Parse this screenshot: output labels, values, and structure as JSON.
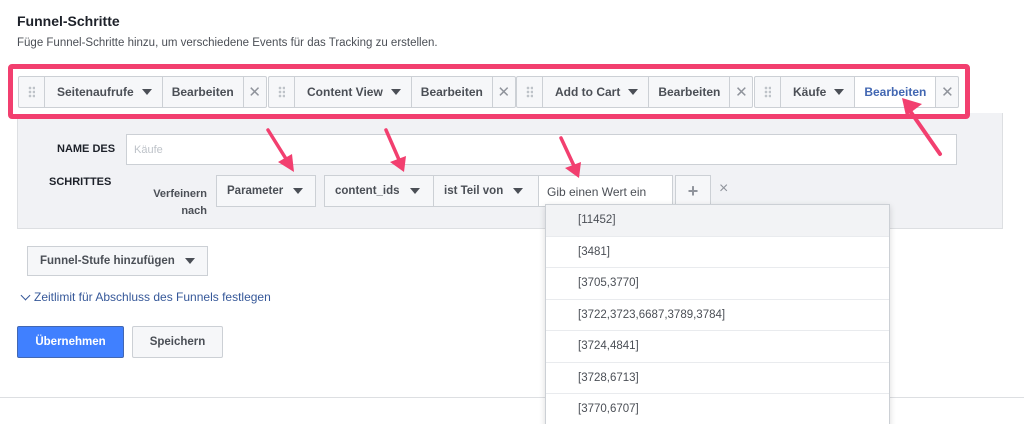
{
  "header": {
    "title": "Funnel-Schritte",
    "subtitle": "Füge Funnel-Schritte hinzu, um verschiedene Events für das Tracking zu erstellen."
  },
  "steps": [
    {
      "name": "Seitenaufrufe",
      "edit_label": "Bearbeiten",
      "active": false
    },
    {
      "name": "Content View",
      "edit_label": "Bearbeiten",
      "active": false
    },
    {
      "name": "Add to Cart",
      "edit_label": "Bearbeiten",
      "active": false
    },
    {
      "name": "Käufe",
      "edit_label": "Bearbeiten",
      "active": true
    }
  ],
  "step_form": {
    "name_label_line1": "NAME DES",
    "name_label_line2": "SCHRITTES",
    "name_placeholder": "Käufe",
    "refine_label": "Verfeinern nach",
    "parameter_select": "Parameter",
    "field_select": "content_ids",
    "operator_select": "ist Teil von",
    "value_placeholder": "Gib einen Wert ein",
    "add_symbol": "+",
    "remove_symbol": "×"
  },
  "dropdown_options": [
    "[11452]",
    "[3481]",
    "[3705,3770]",
    "[3722,3723,6687,3789,3784]",
    "[3724,4841]",
    "[3728,6713]",
    "[3770,6707]"
  ],
  "actions": {
    "add_stage_label": "Funnel-Stufe hinzufügen",
    "time_limit_label": "Zeitlimit für Abschluss des Funnels festlegen",
    "apply_label": "Übernehmen",
    "save_label": "Speichern"
  },
  "colors": {
    "highlight": "#f23f6f",
    "accent_blue": "#4080ff",
    "link_blue": "#365899",
    "active_edit": "#4267b2"
  }
}
